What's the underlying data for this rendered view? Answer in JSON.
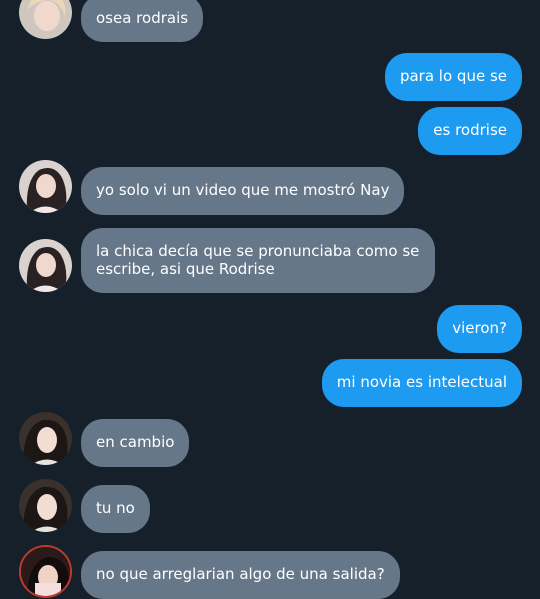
{
  "messages": [
    {
      "side": "in",
      "text": "osea rodrais",
      "avatar": "avatar-blonde-person"
    },
    {
      "side": "out",
      "text": "para lo que se"
    },
    {
      "side": "out",
      "text": "es rodrise"
    },
    {
      "side": "in",
      "text": "yo solo vi un video que me mostró Nay",
      "avatar": "avatar-dark-hair-girl"
    },
    {
      "side": "in",
      "text": "la chica decía que se pronunciaba como se escribe, asi que Rodrise",
      "avatar": "avatar-dark-hair-girl"
    },
    {
      "side": "out",
      "text": "vieron?"
    },
    {
      "side": "out",
      "text": "mi novia es intelectual"
    },
    {
      "side": "in",
      "text": "en cambio",
      "avatar": "avatar-long-hair-girl"
    },
    {
      "side": "in",
      "text": "tu no",
      "avatar": "avatar-long-hair-girl"
    },
    {
      "side": "in",
      "text": "no que arreglarian algo de una salida?",
      "avatar": "avatar-red-ring-girl"
    }
  ],
  "colors": {
    "background": "#16202a",
    "incoming_bubble": "#67778a",
    "outgoing_bubble": "#1d9bf0"
  }
}
